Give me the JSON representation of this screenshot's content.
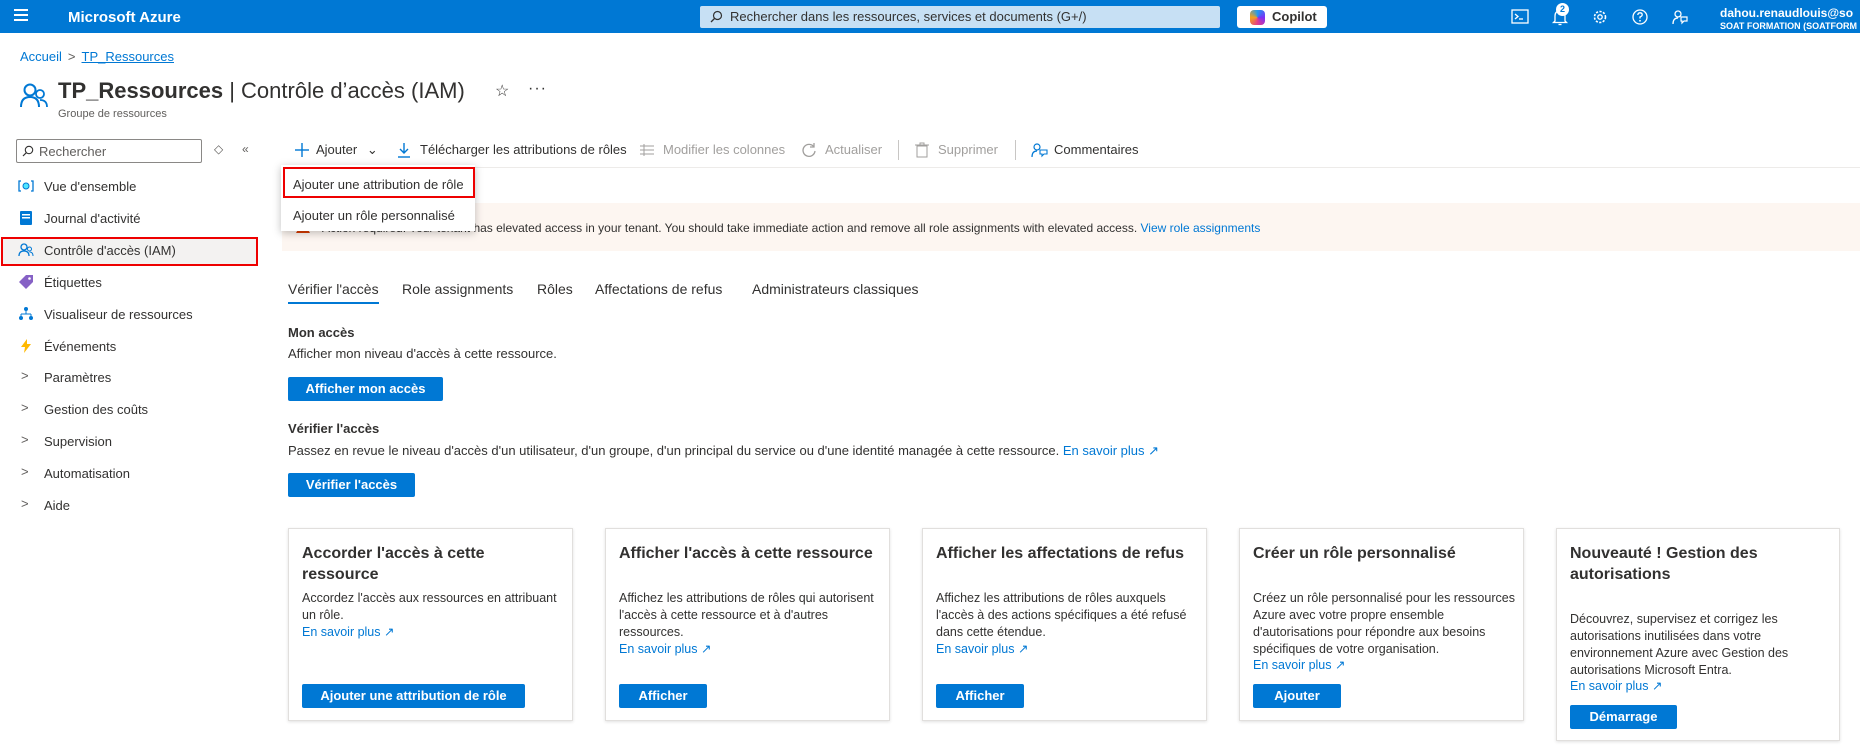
{
  "topbar": {
    "brand": "Microsoft Azure",
    "search_placeholder": "Rechercher dans les ressources, services et documents (G+/)",
    "copilot": "Copilot",
    "notifications_count": "2",
    "user_name": "dahou.renaudlouis@so",
    "user_org": "SOAT FORMATION (SOATFORM"
  },
  "breadcrumb": {
    "home": "Accueil",
    "current": "TP_Ressources"
  },
  "page": {
    "title_resource": "TP_Ressources",
    "title_section": "Contrôle d’accès (IAM)",
    "subtitle": "Groupe de ressources",
    "more": "···"
  },
  "sidebar": {
    "search_placeholder": "Rechercher",
    "items": [
      {
        "label": "Vue d'ensemble",
        "icon": "overview-icon"
      },
      {
        "label": "Journal d'activité",
        "icon": "activity-log-icon"
      },
      {
        "label": "Contrôle d'accès (IAM)",
        "icon": "iam-icon"
      },
      {
        "label": "Étiquettes",
        "icon": "tag-icon"
      },
      {
        "label": "Visualiseur de ressources",
        "icon": "resource-visualizer-icon"
      },
      {
        "label": "Événements",
        "icon": "lightning-icon"
      },
      {
        "label": "Paramètres",
        "icon": "chevron-right-icon"
      },
      {
        "label": "Gestion des coûts",
        "icon": "chevron-right-icon"
      },
      {
        "label": "Supervision",
        "icon": "chevron-right-icon"
      },
      {
        "label": "Automatisation",
        "icon": "chevron-right-icon"
      },
      {
        "label": "Aide",
        "icon": "chevron-right-icon"
      }
    ]
  },
  "toolbar": {
    "add": "Ajouter",
    "download": "Télécharger les attributions de rôles",
    "edit_columns": "Modifier les colonnes",
    "refresh": "Actualiser",
    "delete": "Supprimer",
    "feedback": "Commentaires"
  },
  "dropdown": {
    "items": [
      "Ajouter une attribution de rôle",
      "Ajouter un rôle personnalisé"
    ]
  },
  "alert": {
    "text": "Action required: Your tenant has elevated access in your tenant. You should take immediate action and remove all role assignments with elevated access.",
    "link": "View role assignments"
  },
  "tabs": [
    "Vérifier l'accès",
    "Role assignments",
    "Rôles",
    "Affectations de refus",
    "Administrateurs classiques"
  ],
  "my_access": {
    "title": "Mon accès",
    "desc": "Afficher mon niveau d'accès à cette ressource.",
    "button": "Afficher mon accès"
  },
  "check_access": {
    "title": "Vérifier l'accès",
    "desc": "Passez en revue le niveau d'accès d'un utilisateur, d'un groupe, d'un principal du service ou d'une identité managée à cette ressource.",
    "link": "En savoir plus",
    "button": "Vérifier l'accès"
  },
  "cards": [
    {
      "title": "Accorder l'accès à cette ressource",
      "desc": "Accordez l'accès aux ressources en attribuant un rôle.",
      "link": "En savoir plus",
      "button": "Ajouter une attribution de rôle"
    },
    {
      "title": "Afficher l'accès à cette ressource",
      "desc": "Affichez les attributions de rôles qui autorisent l'accès à cette ressource et à d'autres ressources.",
      "link": "En savoir plus",
      "button": "Afficher"
    },
    {
      "title": "Afficher les affectations de refus",
      "desc": "Affichez les attributions de rôles auxquels l'accès à des actions spécifiques a été refusé dans cette étendue.",
      "link": "En savoir plus",
      "button": "Afficher"
    },
    {
      "title": "Créer un rôle personnalisé",
      "desc": "Créez un rôle personnalisé pour les ressources Azure avec votre propre ensemble d'autorisations pour répondre aux besoins spécifiques de votre organisation.",
      "link": "En savoir plus",
      "button": "Ajouter"
    },
    {
      "title": "Nouveauté ! Gestion des autorisations",
      "desc": "Découvrez, supervisez et corrigez les autorisations inutilisées dans votre environnement Azure avec Gestion des autorisations Microsoft Entra.",
      "link": "En savoir plus",
      "button": "Démarrage"
    }
  ]
}
